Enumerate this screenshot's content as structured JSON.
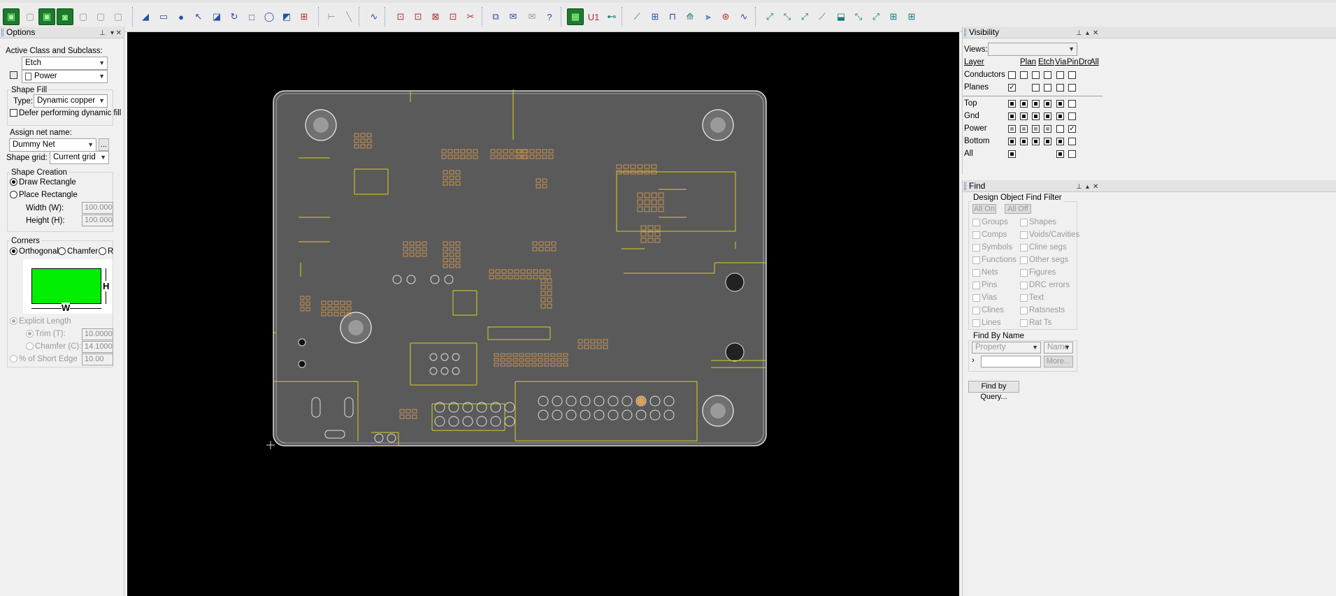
{
  "toolbar": {
    "icons": [
      {
        "name": "shape-add-icon",
        "glyph": "▣",
        "kind": "g"
      },
      {
        "name": "shape-select-icon",
        "glyph": "▢",
        "kind": "gy"
      },
      {
        "name": "shape-edit-icon",
        "glyph": "▣",
        "kind": "g"
      },
      {
        "name": "shape-merge-icon",
        "glyph": "◙",
        "kind": "g"
      },
      {
        "name": "shape-void-icon",
        "glyph": "▢",
        "kind": "gy"
      },
      {
        "name": "shape-delete-icon",
        "glyph": "▢",
        "kind": "gy"
      },
      {
        "name": "shape-islands-icon",
        "glyph": "▢",
        "kind": "gy"
      },
      {
        "name": "add-line-icon",
        "glyph": "◢",
        "kind": "b"
      },
      {
        "name": "add-rect-icon",
        "glyph": "▭",
        "kind": "b"
      },
      {
        "name": "add-circle-icon",
        "glyph": "●",
        "kind": "b"
      },
      {
        "name": "select-arrow-icon",
        "glyph": "↖",
        "kind": "b"
      },
      {
        "name": "shape-poly-icon",
        "glyph": "◪",
        "kind": "b"
      },
      {
        "name": "rotate-icon",
        "glyph": "↻",
        "kind": "b"
      },
      {
        "name": "square-icon",
        "glyph": "□",
        "kind": "b"
      },
      {
        "name": "circle-outline-icon",
        "glyph": "◯",
        "kind": "b"
      },
      {
        "name": "frame-icon",
        "glyph": "◩",
        "kind": "b"
      },
      {
        "name": "merge-shapes-icon",
        "glyph": "⊞",
        "kind": "r"
      },
      {
        "name": "dimension-icon",
        "glyph": "⊢",
        "kind": "gy"
      },
      {
        "name": "diagonal-icon",
        "glyph": "╲",
        "kind": "gy"
      },
      {
        "name": "route-icon",
        "glyph": "∿",
        "kind": "b"
      },
      {
        "name": "component-add-icon",
        "glyph": "⊡",
        "kind": "r"
      },
      {
        "name": "component-edit-icon",
        "glyph": "⊡",
        "kind": "r"
      },
      {
        "name": "component-gift-icon",
        "glyph": "⊠",
        "kind": "r"
      },
      {
        "name": "component-swap-icon",
        "glyph": "⊡",
        "kind": "r"
      },
      {
        "name": "component-delete-icon",
        "glyph": "✂",
        "kind": "r"
      },
      {
        "name": "copy-icon",
        "glyph": "⧉",
        "kind": "b"
      },
      {
        "name": "mail-icon",
        "glyph": "✉",
        "kind": "b"
      },
      {
        "name": "mail-disabled-icon",
        "glyph": "✉",
        "kind": "gy"
      },
      {
        "name": "help-icon",
        "glyph": "?",
        "kind": "b"
      },
      {
        "name": "place-component-icon",
        "glyph": "▦",
        "kind": "g"
      },
      {
        "name": "ref-des-icon",
        "glyph": "U1",
        "kind": "r"
      },
      {
        "name": "connector-icon",
        "glyph": "⊷",
        "kind": "t"
      },
      {
        "name": "slide-icon",
        "glyph": "⟋",
        "kind": "t"
      },
      {
        "name": "fanout-icon",
        "glyph": "⊞",
        "kind": "b"
      },
      {
        "name": "tune-icon",
        "glyph": "⊓",
        "kind": "b"
      },
      {
        "name": "spread-icon",
        "glyph": "⟰",
        "kind": "t"
      },
      {
        "name": "diff-pair-icon",
        "glyph": "⫸",
        "kind": "b"
      },
      {
        "name": "via-array-icon",
        "glyph": "⊛",
        "kind": "r"
      },
      {
        "name": "wave-icon",
        "glyph": "∿",
        "kind": "b"
      },
      {
        "name": "route-a-icon",
        "glyph": "⤢",
        "kind": "t"
      },
      {
        "name": "route-b-icon",
        "glyph": "⤡",
        "kind": "t"
      },
      {
        "name": "route-c-icon",
        "glyph": "⤢",
        "kind": "t"
      },
      {
        "name": "route-d-icon",
        "glyph": "⟋",
        "kind": "t"
      },
      {
        "name": "route-e-icon",
        "glyph": "⬓",
        "kind": "t"
      },
      {
        "name": "route-f-icon",
        "glyph": "⤡",
        "kind": "t"
      },
      {
        "name": "route-g-icon",
        "glyph": "⤢",
        "kind": "t"
      },
      {
        "name": "route-h-icon",
        "glyph": "⊞",
        "kind": "t"
      },
      {
        "name": "route-i-icon",
        "glyph": "⊞",
        "kind": "t"
      }
    ]
  },
  "options": {
    "title": "Options",
    "active_class_label": "Active Class and Subclass:",
    "class_value": "Etch",
    "subclass_value": "Power",
    "shape_fill_group": "Shape Fill",
    "type_label": "Type:",
    "type_value": "Dynamic copper",
    "defer_label": "Defer performing dynamic fill",
    "assign_net_label": "Assign net name:",
    "net_value": "Dummy Net",
    "more_button": "...",
    "shape_grid_label": "Shape grid:",
    "shape_grid_value": "Current grid",
    "shape_creation_group": "Shape Creation",
    "draw_rectangle": "Draw Rectangle",
    "place_rectangle": "Place Rectangle",
    "width_label": "Width (W):",
    "width_value": "100.00000",
    "height_label": "Height (H):",
    "height_value": "100.00000",
    "corners_group": "Corners",
    "orthogonal": "Orthogonal",
    "chamfer": "Chamfer",
    "round": "R",
    "preview_h": "H",
    "preview_w": "W",
    "preview_color": "#00ee00",
    "explicit_length": "Explicit Length",
    "trim_label": "Trim (T):",
    "trim_value": "10.00000",
    "chamfer_c_label": "Chamfer (C):",
    "chamfer_c_value": "14.10000",
    "short_edge_label": "% of Short Edge",
    "short_edge_value": "10.00"
  },
  "canvas": {
    "background": "#000000",
    "board_fill": "#5a5a5a",
    "trace_color": "#d8d020",
    "pad_color": "#e0a050",
    "outline_color": "#d8d8d8"
  },
  "visibility": {
    "title": "Visibility",
    "views_label": "Views:",
    "views_value": "",
    "headers": [
      "Layer",
      "Plan",
      "Etch",
      "Via",
      "Pin",
      "Drc",
      "All"
    ],
    "rows": [
      {
        "label": "Conductors",
        "cells": [
          "e",
          "e",
          "e",
          "e",
          "e",
          "e"
        ]
      },
      {
        "label": "Planes",
        "cells": [
          "c",
          "",
          "e",
          "e",
          "e",
          "e"
        ]
      },
      {
        "label": "Top",
        "cells": [
          "f",
          "f",
          "f",
          "f",
          "f",
          "e"
        ]
      },
      {
        "label": "Gnd",
        "cells": [
          "f",
          "f",
          "f",
          "f",
          "f",
          "e"
        ]
      },
      {
        "label": "Power",
        "cells": [
          "p",
          "p",
          "p",
          "p",
          "e",
          "c"
        ]
      },
      {
        "label": "Bottom",
        "cells": [
          "f",
          "f",
          "f",
          "f",
          "f",
          "e"
        ]
      },
      {
        "label": "All",
        "cells": [
          "f",
          "",
          "",
          "",
          "f",
          "e"
        ]
      }
    ]
  },
  "find": {
    "title": "Find",
    "filter_group": "Design Object Find Filter",
    "all_on": "All On",
    "all_off": "All Off",
    "left_items": [
      "Groups",
      "Comps",
      "Symbols",
      "Functions",
      "Nets",
      "Pins",
      "Vias",
      "Clines",
      "Lines"
    ],
    "right_items": [
      "Shapes",
      "Voids/Cavities",
      "Cline segs",
      "Other segs",
      "Figures",
      "DRC errors",
      "Text",
      "Ratsnests",
      "Rat Ts"
    ],
    "find_by_name_group": "Find By Name",
    "property_value": "Property",
    "name_value": "Name",
    "more_button": "More...",
    "find_by_query": "Find by Query..."
  }
}
